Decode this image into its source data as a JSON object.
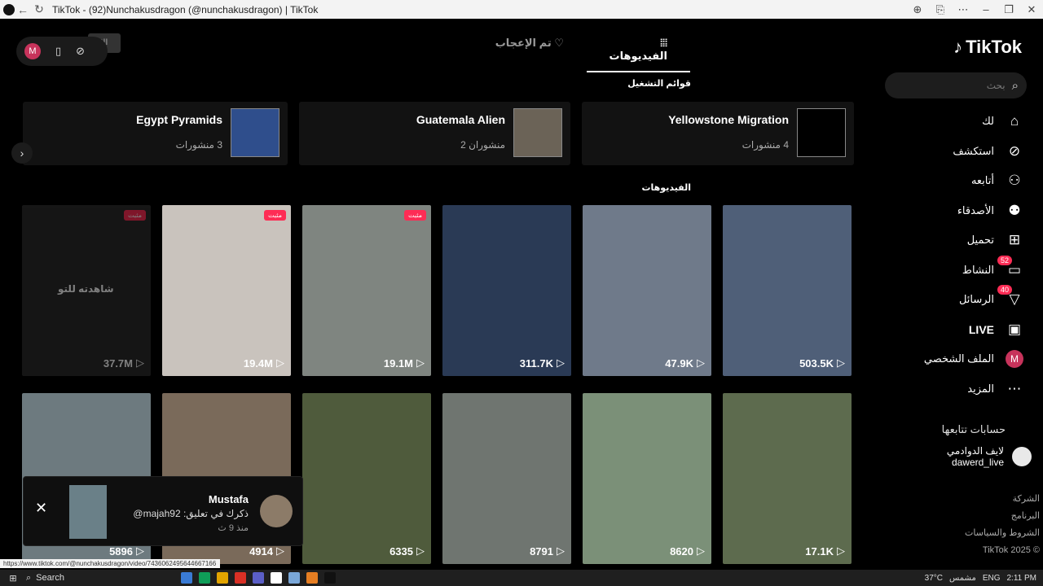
{
  "window": {
    "title": "TikTok - (92)Nunchakusdragon (@nunchakusdragon) | TikTok"
  },
  "floating": {
    "avatar_letter": "M",
    "ghost_label": "الا"
  },
  "brand": {
    "name": "TikTok"
  },
  "search": {
    "placeholder": "بحث"
  },
  "nav": [
    {
      "label": "لك",
      "icon": "home-icon"
    },
    {
      "label": "استكشف",
      "icon": "compass-icon"
    },
    {
      "label": "أتابعه",
      "icon": "following-icon"
    },
    {
      "label": "الأصدقاء",
      "icon": "friends-icon"
    },
    {
      "label": "تحميل",
      "icon": "upload-icon"
    },
    {
      "label": "النشاط",
      "icon": "activity-icon",
      "badge": "52"
    },
    {
      "label": "الرسائل",
      "icon": "messages-icon",
      "badge": "40"
    },
    {
      "label": "LIVE",
      "icon": "live-icon"
    },
    {
      "label": "الملف الشخصي",
      "icon": "profile-avatar",
      "avatar": "M"
    },
    {
      "label": "المزيد",
      "icon": "more-icon"
    }
  ],
  "following": {
    "title": "حسابات تتابعها",
    "accounts": [
      {
        "display": "لايف الدوادمي",
        "handle": "dawerd_live"
      }
    ]
  },
  "footer": [
    "الشركة",
    "البرنامج",
    "الشروط والسياسات",
    "© 2025 TikTok"
  ],
  "tabs": [
    {
      "label": "الفيديوهات",
      "icon": "grid-icon",
      "active": true
    },
    {
      "label": "تم الإعجاب",
      "icon": "heart-icon",
      "active": false
    }
  ],
  "playlists_title": "قوائم التشغيل",
  "playlists": [
    {
      "name": "Yellowstone Migration",
      "count": "4 منشورات",
      "thumb_color": "#000000"
    },
    {
      "name": "Guatemala Alien",
      "count": "منشوران 2",
      "thumb_color": "#6b6357"
    },
    {
      "name": "Egypt Pyramids",
      "count": "3 منشورات",
      "thumb_color": "#2f4e8c"
    }
  ],
  "videos_title": "الفيديوهات",
  "videos": [
    {
      "views": "503.5K",
      "color": "#4f5f78",
      "pinned": false
    },
    {
      "views": "47.9K",
      "color": "#6f7a8a",
      "pinned": false
    },
    {
      "views": "311.7K",
      "color": "#2a3a55",
      "pinned": false
    },
    {
      "views": "19.1M",
      "color": "#7f8580",
      "pinned": true,
      "pinned_label": "مثبت"
    },
    {
      "views": "19.4M",
      "color": "#c9c3bd",
      "pinned": true,
      "pinned_label": "مثبت"
    },
    {
      "views": "37.7M",
      "color": "#2b2b2b",
      "pinned": true,
      "pinned_label": "مثبت",
      "overlay": "شاهدته للتو",
      "dim": true
    },
    {
      "views": "17.1K",
      "color": "#5d6b4e",
      "pinned": false
    },
    {
      "views": "8620",
      "color": "#7b9078",
      "pinned": false
    },
    {
      "views": "8791",
      "color": "#6f7570",
      "pinned": false
    },
    {
      "views": "6335",
      "color": "#4f5b3c",
      "pinned": false
    },
    {
      "views": "4914",
      "color": "#7a6a5a",
      "pinned": false
    },
    {
      "views": "5896",
      "color": "#6d7a7f",
      "pinned": false
    }
  ],
  "notification": {
    "user": "Mustafa",
    "message": "ذكرك في تعليق: majah92@",
    "time": "منذ 9 ث"
  },
  "status_url": "https://www.tiktok.com/@nunchakusdragon/video/7436062495644667166",
  "taskbar": {
    "search_label": "Search",
    "weather": "37°C",
    "weather_desc": "مشمس",
    "lang": "ENG",
    "time": "2:11 PM"
  }
}
